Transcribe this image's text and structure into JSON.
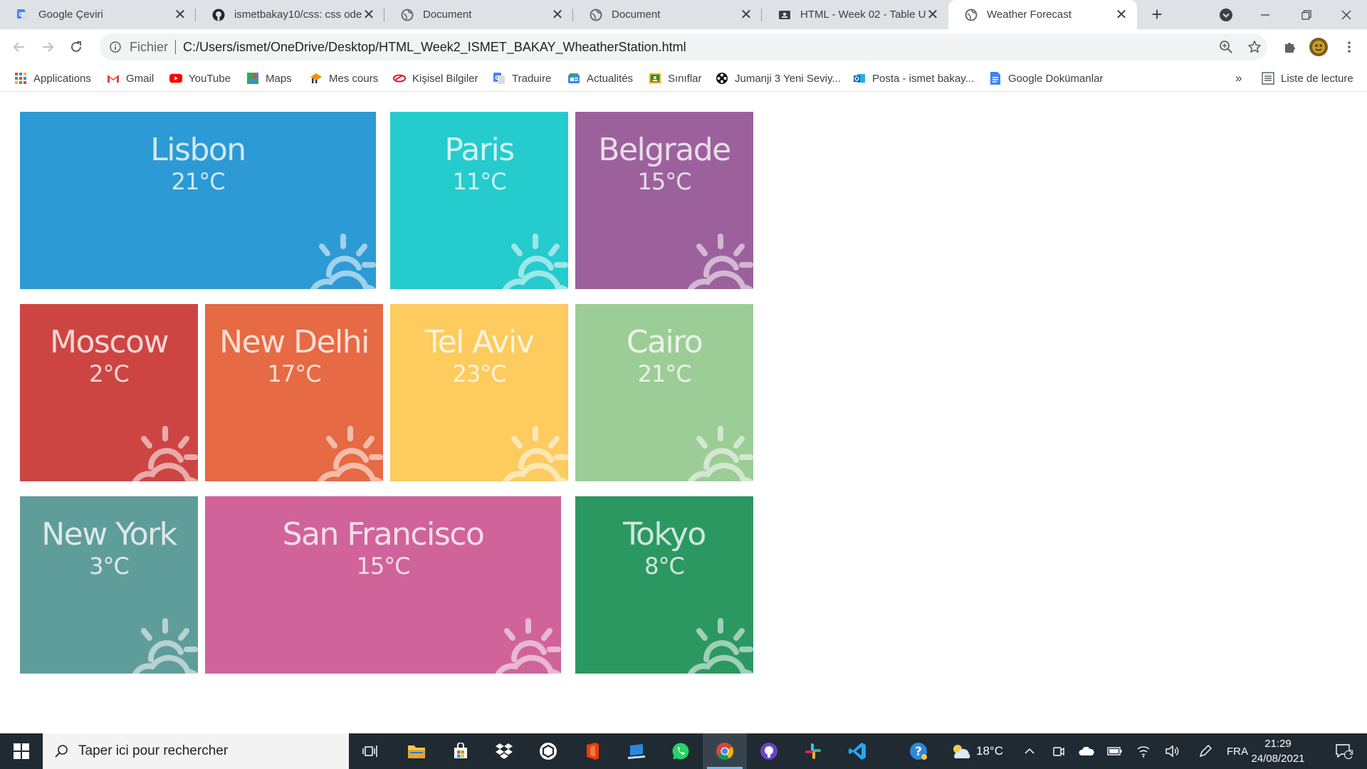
{
  "browser": {
    "tabs": [
      {
        "title": "Google Çeviri",
        "icon": "google-translate-icon"
      },
      {
        "title": "ismetbakay10/css: css odevleri",
        "icon": "github-icon"
      },
      {
        "title": "Document",
        "icon": "globe-icon"
      },
      {
        "title": "Document",
        "icon": "globe-icon"
      },
      {
        "title": "HTML - Week 02 - Table Usage",
        "icon": "classroom-icon"
      },
      {
        "title": "Weather Forecast",
        "icon": "globe-icon"
      }
    ],
    "address": {
      "scheme_label": "Fichier",
      "url": "C:/Users/ismet/OneDrive/Desktop/HTML_Week2_ISMET_BAKAY_WheatherStation.html"
    },
    "bookmarks": [
      {
        "label": "Applications",
        "icon": "apps-grid-icon"
      },
      {
        "label": "Gmail",
        "icon": "gmail-icon"
      },
      {
        "label": "YouTube",
        "icon": "youtube-icon"
      },
      {
        "label": "Maps",
        "icon": "maps-icon"
      },
      {
        "label": "Mes cours",
        "icon": "courses-icon"
      },
      {
        "label": "Kişisel Bilgiler",
        "icon": "personal-info-icon"
      },
      {
        "label": "Traduire",
        "icon": "translate-icon"
      },
      {
        "label": "Actualités",
        "icon": "news-icon"
      },
      {
        "label": "Sınıflar",
        "icon": "classroom-icon"
      },
      {
        "label": "Jumanji 3 Yeni Seviy...",
        "icon": "film-reel-icon"
      },
      {
        "label": "Posta - ismet bakay...",
        "icon": "outlook-icon"
      },
      {
        "label": "Google Dokümanlar",
        "icon": "docs-icon"
      }
    ],
    "overflow_label": "»",
    "reading_list_label": "Liste de lecture"
  },
  "weather": {
    "tiles": [
      {
        "city": "Lisbon",
        "temp": "21°C",
        "color": "#2c9ad4"
      },
      {
        "city": "Paris",
        "temp": "11°C",
        "color": "#25cbcd"
      },
      {
        "city": "Belgrade",
        "temp": "15°C",
        "color": "#9c619d"
      },
      {
        "city": "Moscow",
        "temp": "2°C",
        "color": "#cd4543"
      },
      {
        "city": "New Delhi",
        "temp": "17°C",
        "color": "#e66a43"
      },
      {
        "city": "Tel Aviv",
        "temp": "23°C",
        "color": "#fdcb5e"
      },
      {
        "city": "Cairo",
        "temp": "21°C",
        "color": "#9ccd96"
      },
      {
        "city": "New York",
        "temp": "3°C",
        "color": "#5f9d9a"
      },
      {
        "city": "San Francisco",
        "temp": "15°C",
        "color": "#d0639a"
      },
      {
        "city": "Tokyo",
        "temp": "8°C",
        "color": "#2b9862"
      }
    ]
  },
  "taskbar": {
    "search_placeholder": "Taper ici pour rechercher",
    "weather_temp": "18°C",
    "language": "FRA",
    "time": "21:29",
    "date": "24/08/2021",
    "notification_count": "3"
  }
}
